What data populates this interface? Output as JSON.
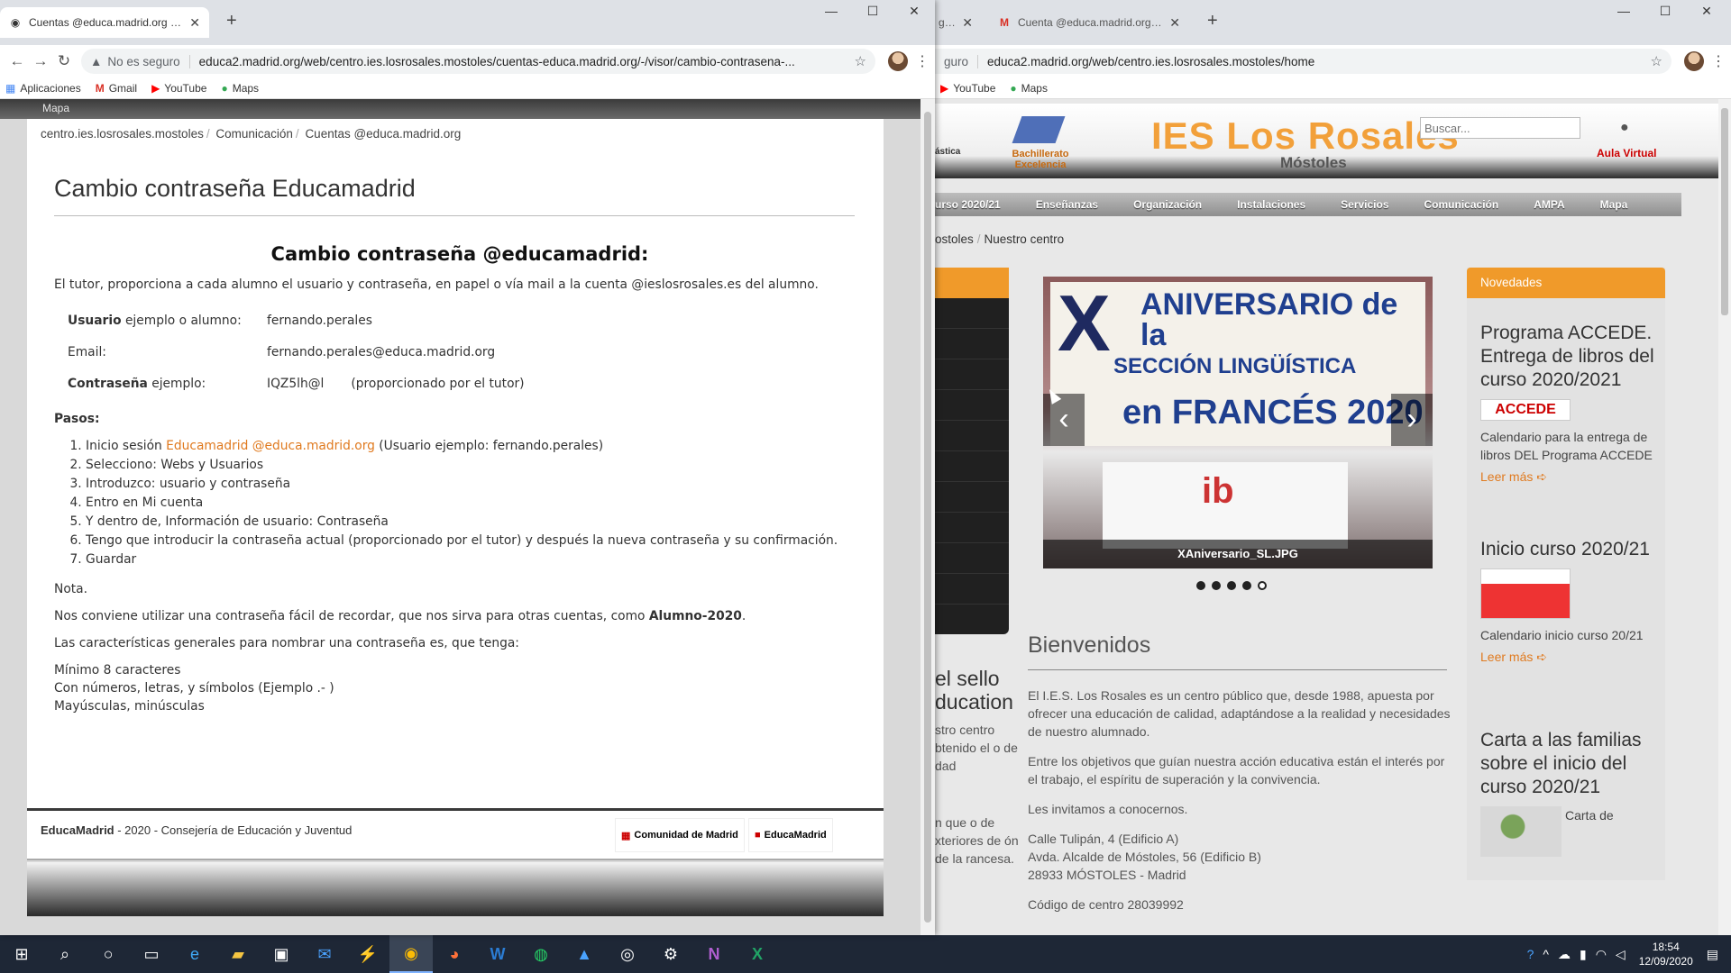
{
  "left_window": {
    "tab_title": "Cuentas @educa.madrid.org | ce",
    "url_warning": "No es seguro",
    "url": "educa2.madrid.org/web/centro.ies.losrosales.mostoles/cuentas-educa.madrid.org/-/visor/cambio-contrasena-...",
    "bookmarks": [
      "Aplicaciones",
      "Gmail",
      "YouTube",
      "Maps"
    ],
    "top_strip": "Mapa",
    "breadcrumb": [
      "centro.ies.losrosales.mostoles",
      "Comunicación",
      "Cuentas @educa.madrid.org"
    ],
    "page_title": "Cambio contraseña Educamadrid",
    "heading": "Cambio contraseña @educamadrid:",
    "intro": "El tutor, proporciona a cada alumno el usuario y contraseña, en papel o vía mail a la cuenta @ieslosrosales.es del alumno.",
    "user_label_bold": "Usuario",
    "user_label_rest": " ejemplo o alumno:",
    "user_value": "fernando.perales",
    "email_label": "Email:",
    "email_value": "fernando.perales@educa.madrid.org",
    "pass_label_bold": "Contraseña",
    "pass_label_rest": " ejemplo:",
    "pass_value": "IQZ5lh@l",
    "pass_note": "(proporcionado por el tutor)",
    "steps_title": "Pasos:",
    "step1_pre": "Inicio sesión ",
    "step1_link": "Educamadrid @educa.madrid.org",
    "step1_post": " (Usuario ejemplo:  fernando.perales)",
    "steps": [
      "Selecciono: Webs y Usuarios",
      "Introduzco: usuario y contraseña",
      "Entro en Mi cuenta",
      "Y dentro de, Información de usuario: Contraseña",
      "Tengo que introducir la contraseña actual (proporcionado por el tutor) y después la nueva contraseña y su confirmación.",
      "Guardar"
    ],
    "nota": "Nota.",
    "conviene_pre": "Nos conviene utilizar una contraseña fácil de recordar, que nos sirva para otras cuentas, como ",
    "conviene_bold": "Alumno-2020",
    "conviene_post": ".",
    "caracteristicas": "Las características generales para nombrar una contraseña es, que tenga:",
    "rules": [
      "Mínimo 8 caracteres",
      "Con números, letras, y símbolos (Ejemplo .- )",
      "Mayúsculas, minúsculas"
    ],
    "footer_brand": "EducaMadrid",
    "footer_rest": " - 2020 - Consejería de Educación y Juventud",
    "footer_logo1": "Comunidad de Madrid",
    "footer_logo2": "EducaMadrid"
  },
  "right_window": {
    "tab1_title": "gros",
    "tab2_title": "Cuenta @educa.madrid.org - Us",
    "url": "gurо",
    "url_full": "educa2.madrid.org/web/centro.ies.losrosales.mostoles/home",
    "bookmarks": [
      "YouTube",
      "Maps"
    ],
    "site_title": "IES Los Rosales",
    "site_sub": "Móstoles",
    "search_placeholder": "Buscar...",
    "aula": "Aula Virtual",
    "bachi": "Bachillerato Excelencia",
    "estica": "ástica",
    "nav": [
      "urso 2020/21",
      "Enseñanzas",
      "Organización",
      "Instalaciones",
      "Servicios",
      "Comunicación",
      "AMPA",
      "Mapa"
    ],
    "crumb_pre": "ostoles",
    "crumb_last": "Nuestro centro",
    "carousel_caption": "XAniversario_SL.JPG",
    "banner": {
      "x": "X",
      "t1": "ANIVERSARIO de la",
      "t2": "SECCIÓN LINGÜÍSTICA",
      "t3": "en FRANCÉS 2020"
    },
    "bienvenidos": "Bienvenidos",
    "b_p1": "El I.E.S. Los Rosales es un centro público que, desde 1988, apuesta por ofrecer una educación de calidad, adaptándose a la realidad y necesidades de nuestro alumnado.",
    "b_p2": "Entre los objetivos que guían nuestra acción educativa están el interés por el trabajo, el espíritu de superación y la convivencia.",
    "b_p3": "Les invitamos a conocernos.",
    "addr1": "Calle Tulipán, 4 (Edificio A)",
    "addr2": "Avda. Alcalde de Móstoles, 56 (Edificio B)",
    "addr3": "28933 MÓSTOLES - Madrid",
    "code": "Código de centro 28039992",
    "cut_head": "el sello ducation",
    "cut_lines": "stro centro btenido el o de dad",
    "cut_lines2": "n que o de xteriores de ón de la rancesa.",
    "novedades": "Novedades",
    "news": [
      {
        "title": "Programa ACCEDE. Entrega de libros del curso 2020/2021",
        "desc": "Calendario para la entrega de libros DEL Programa ACCEDE",
        "more": "Leer más ➪"
      },
      {
        "title": "Inicio curso 2020/21",
        "desc": "Calendario inicio curso 20/21",
        "more": "Leer más ➪"
      },
      {
        "title": "Carta a las familias sobre el inicio del curso 2020/21",
        "desc": "Carta de",
        "more": ""
      }
    ]
  },
  "taskbar": {
    "time": "18:54",
    "date": "12/09/2020"
  }
}
